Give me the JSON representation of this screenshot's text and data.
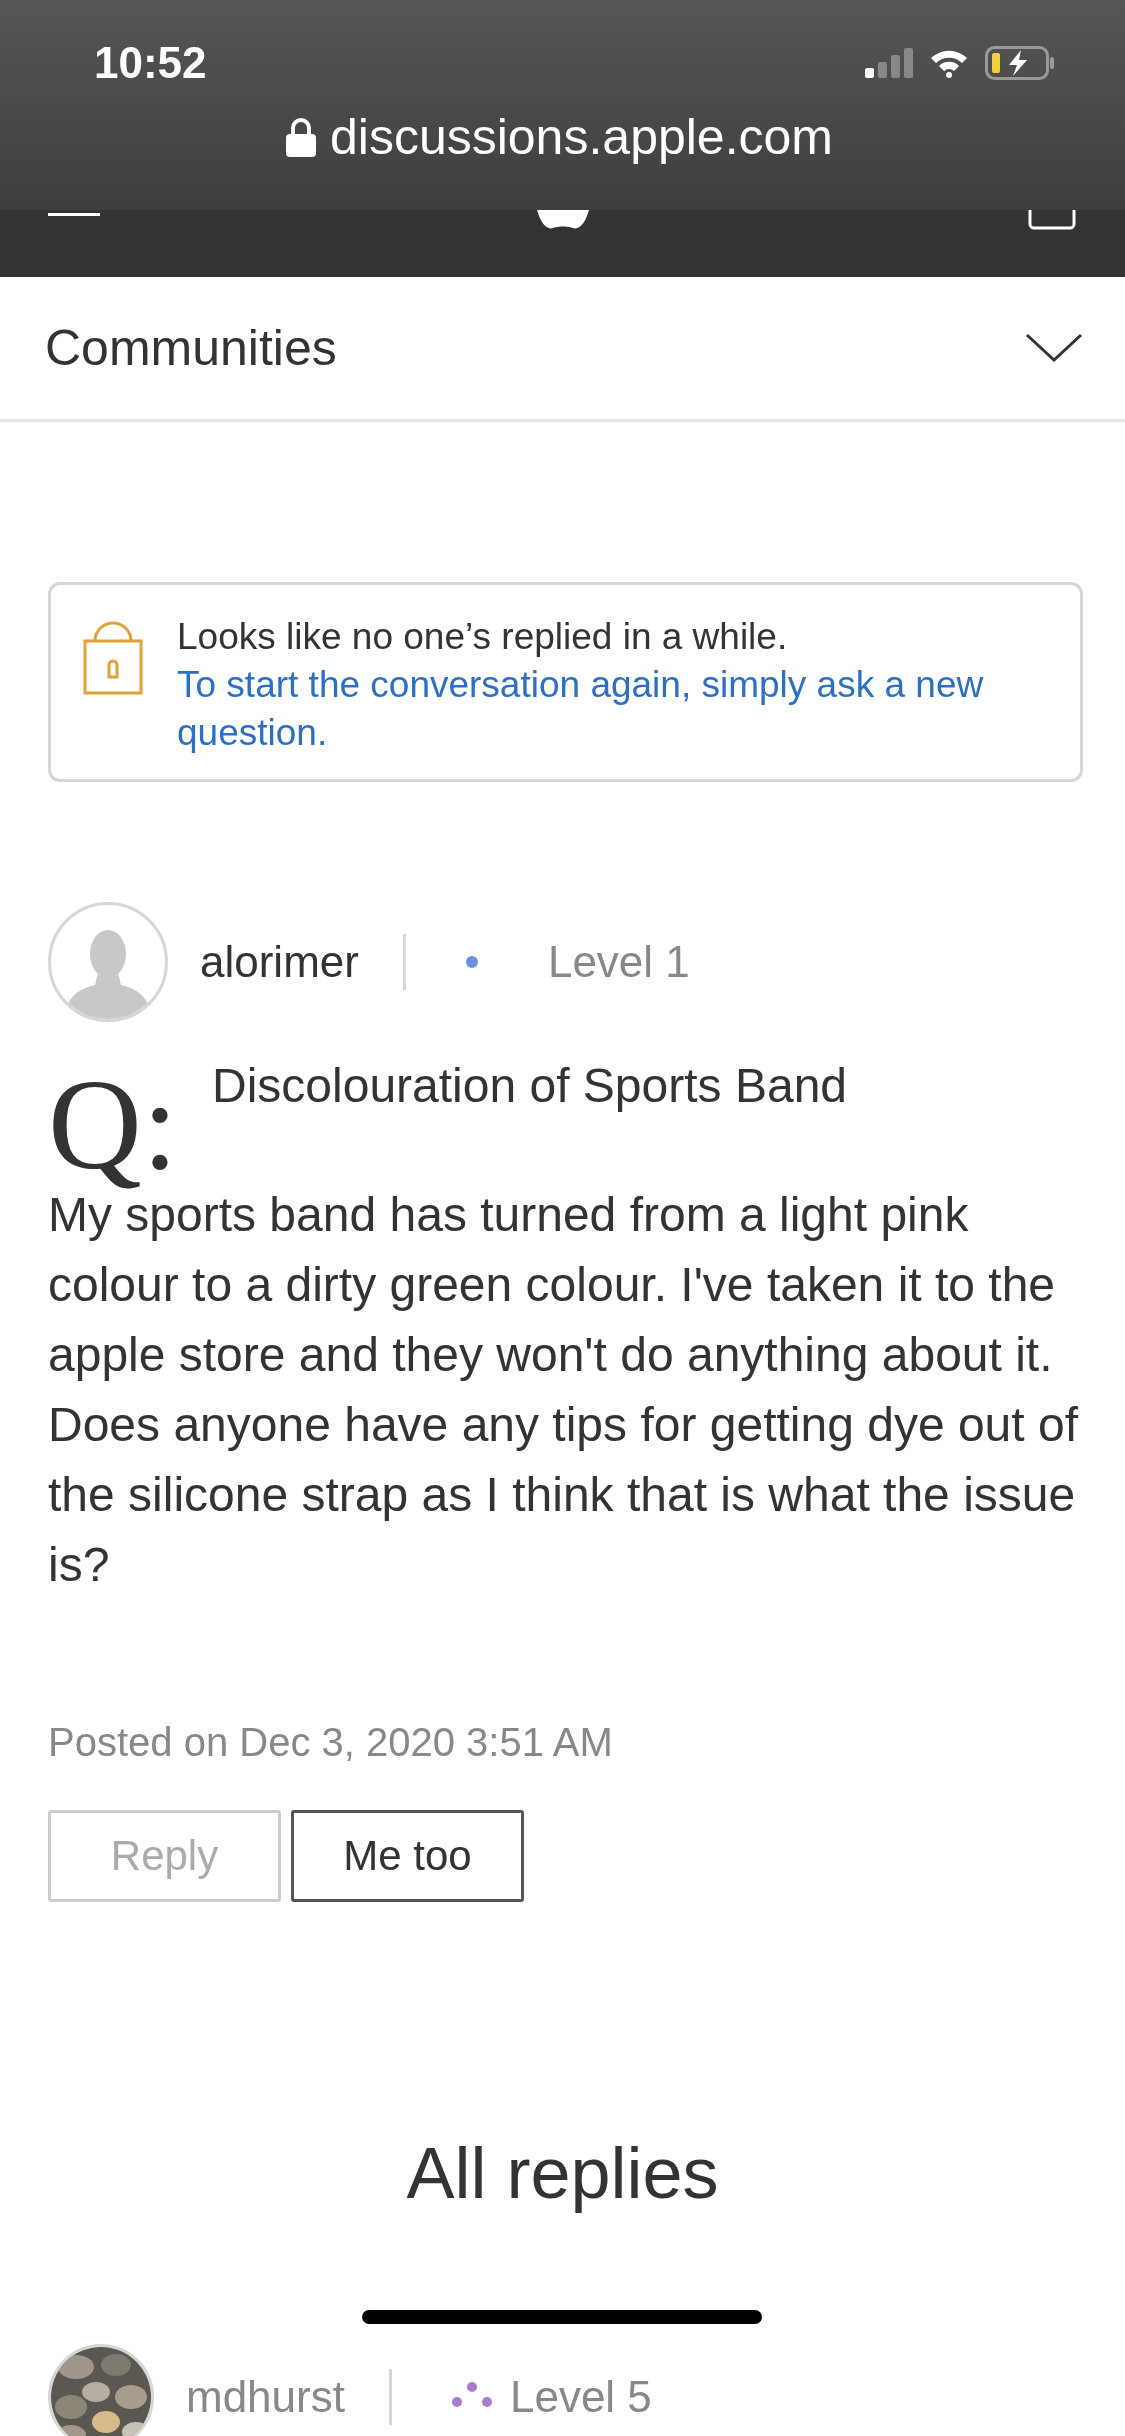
{
  "status_bar": {
    "time": "10:52",
    "url": "discussions.apple.com"
  },
  "community_bar": {
    "label": "Communities"
  },
  "notice": {
    "text": "Looks like no one’s replied in a while.",
    "link": "To start the conversation again, simply ask a new question."
  },
  "question": {
    "author": "alorimer",
    "level": "Level 1",
    "color": "#6d8fe0",
    "q_mark": "Q:",
    "title": "Discolouration of Sports Band",
    "body": "My sports band has turned from a light pink colour to a dirty green colour. I've taken it to the apple store and they won't do anything about it. Does anyone have any tips for getting dye out of the silicone strap as I think that is what the issue is?",
    "posted": "Posted on Dec 3, 2020 3:51 AM",
    "buttons": [
      {
        "label": "Reply",
        "disabled": true
      },
      {
        "label": "Me too",
        "disabled": false
      }
    ]
  },
  "replies": {
    "heading": "All replies",
    "first_reply": {
      "author": "mdhurst",
      "level": "Level 5",
      "color": "#a77fd0"
    }
  }
}
